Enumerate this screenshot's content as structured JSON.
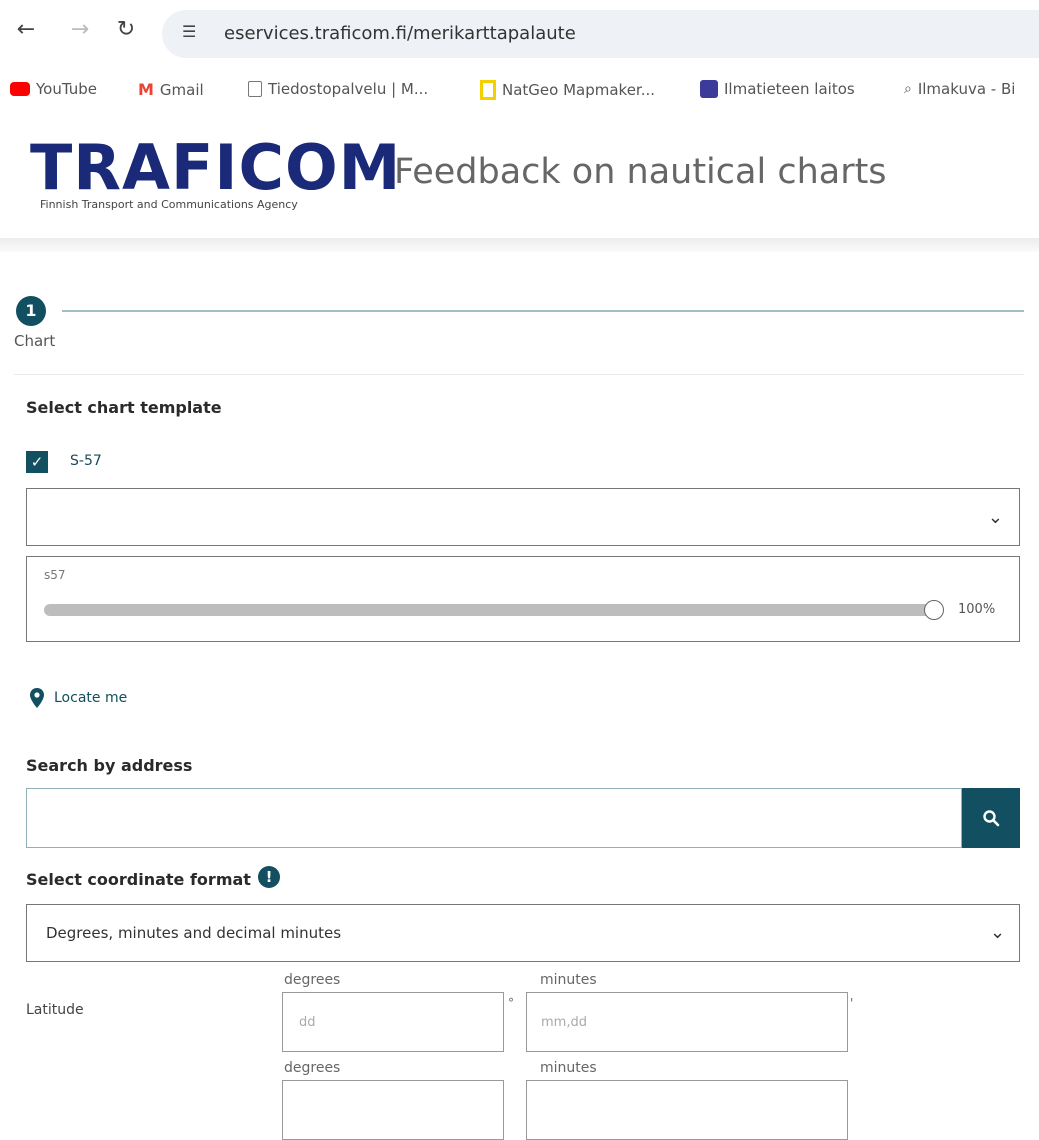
{
  "browser": {
    "url": "eservices.traficom.fi/merikarttapalaute",
    "bookmarks": [
      {
        "label": "YouTube",
        "color": "#ff0000"
      },
      {
        "label": "Gmail",
        "color": "#ea4335"
      },
      {
        "label": "Tiedostopalvelu | M...",
        "color": "#777777"
      },
      {
        "label": "NatGeo Mapmaker...",
        "color": "#f5d000"
      },
      {
        "label": "Ilmatieteen laitos",
        "color": "#3b3b9a"
      },
      {
        "label": "Ilmakuva - Bi",
        "color": "#555555"
      }
    ]
  },
  "header": {
    "logo": "TRAFICOM",
    "logo_sub": "Finnish Transport and Communications Agency",
    "title": "Feedback on nautical charts",
    "accent": "#1a2a78"
  },
  "stepper": {
    "number": "1",
    "label": "Chart",
    "color": "#124f60"
  },
  "chart_template": {
    "heading": "Select chart template",
    "checkbox_label": "S-57",
    "checked": true,
    "select_value": "",
    "layer_name": "s57",
    "opacity": "100%"
  },
  "locate": {
    "label": "Locate me"
  },
  "search": {
    "heading": "Search by address",
    "value": ""
  },
  "coordinates": {
    "heading": "Select coordinate format",
    "format_value": "Degrees, minutes and decimal minutes",
    "latitude_label": "Latitude",
    "degrees_caption": "degrees",
    "minutes_caption": "minutes",
    "degrees_placeholder": "dd",
    "minutes_placeholder": "mm,dd",
    "degree_symbol": "°",
    "minute_symbol": "'"
  }
}
